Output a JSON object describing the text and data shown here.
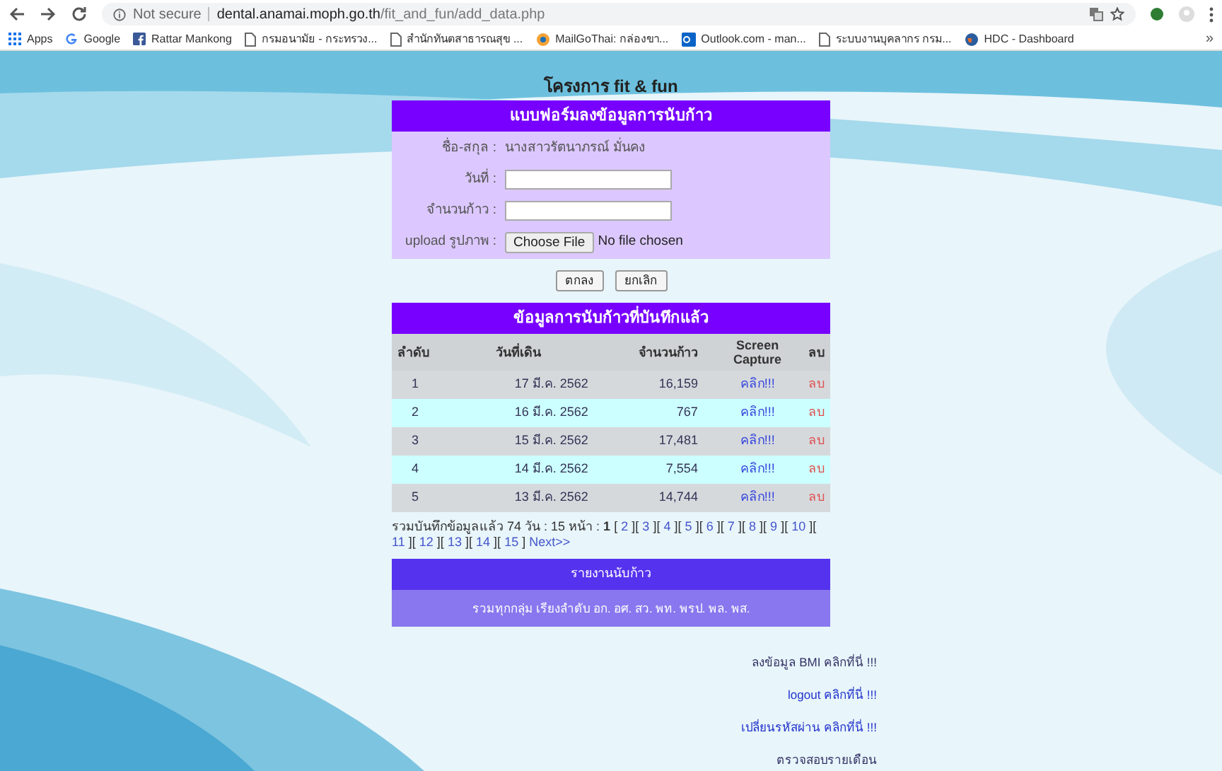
{
  "browser": {
    "security": "Not secure",
    "url_host": "dental.anamai.moph.go.th",
    "url_path": "/fit_and_fun/add_data.php",
    "bookmarks": [
      {
        "label": "Apps",
        "kind": "apps"
      },
      {
        "label": "Google",
        "kind": "google"
      },
      {
        "label": "Rattar Mankong",
        "kind": "facebook"
      },
      {
        "label": "กรมอนามัย - กระทรวง...",
        "kind": "page"
      },
      {
        "label": "สำนักทันตสาธารณสุข ...",
        "kind": "page"
      },
      {
        "label": "MailGoThai: กล่องขา...",
        "kind": "mail"
      },
      {
        "label": "Outlook.com - man...",
        "kind": "outlook"
      },
      {
        "label": "ระบบงานบุคลากร กรม...",
        "kind": "page"
      },
      {
        "label": "HDC - Dashboard",
        "kind": "globe"
      }
    ],
    "overflow": "»"
  },
  "page_title": "โครงการ fit & fun",
  "form": {
    "title": "แบบฟอร์มลงข้อมูลการนับก้าว",
    "fields": [
      {
        "label": "ชื่อ-สกุล :",
        "kind": "static",
        "value": "นางสาวรัตนาภรณ์ มั่นคง"
      },
      {
        "label": "วันที่ :",
        "kind": "text"
      },
      {
        "label": "จำนวนก้าว :",
        "kind": "text"
      },
      {
        "label": "upload รูปภาพ :",
        "kind": "file",
        "button": "Choose File",
        "value": "No file chosen"
      }
    ],
    "buttons": [
      "ตกลง",
      "ยกเลิก"
    ]
  },
  "records": {
    "title": "ข้อมูลการนับก้าวที่บันทึกแล้ว",
    "columns": [
      "ลำดับ",
      "วันที่เดิน",
      "จำนวนก้าว",
      "Screen Capture",
      "ลบ"
    ],
    "rows": [
      [
        "1",
        "17 มี.ค. 2562",
        "16,159",
        "คลิก!!!",
        "ลบ"
      ],
      [
        "2",
        "16 มี.ค. 2562",
        "767",
        "คลิก!!!",
        "ลบ"
      ],
      [
        "3",
        "15 มี.ค. 2562",
        "17,481",
        "คลิก!!!",
        "ลบ"
      ],
      [
        "4",
        "14 มี.ค. 2562",
        "7,554",
        "คลิก!!!",
        "ลบ"
      ],
      [
        "5",
        "13 มี.ค. 2562",
        "14,744",
        "คลิก!!!",
        "ลบ"
      ]
    ]
  },
  "pagination": [
    {
      "kind": "text",
      "text": "รวมบันทึกข้อมูลแล้ว 74 วัน : 15 หน้า :"
    },
    {
      "kind": "current",
      "text": "1"
    },
    {
      "kind": "sep",
      "text": "["
    },
    {
      "kind": "link",
      "text": "2"
    },
    {
      "kind": "sep",
      "text": "]["
    },
    {
      "kind": "link",
      "text": "3"
    },
    {
      "kind": "sep",
      "text": "]["
    },
    {
      "kind": "link",
      "text": "4"
    },
    {
      "kind": "sep",
      "text": "]["
    },
    {
      "kind": "link",
      "text": "5"
    },
    {
      "kind": "sep",
      "text": "]["
    },
    {
      "kind": "link",
      "text": "6"
    },
    {
      "kind": "sep",
      "text": "]["
    },
    {
      "kind": "link",
      "text": "7"
    },
    {
      "kind": "sep",
      "text": "]["
    },
    {
      "kind": "link",
      "text": "8"
    },
    {
      "kind": "sep",
      "text": "]["
    },
    {
      "kind": "link",
      "text": "9"
    },
    {
      "kind": "sep",
      "text": "]["
    },
    {
      "kind": "link",
      "text": "10"
    },
    {
      "kind": "sep",
      "text": "]["
    },
    {
      "kind": "link",
      "text": "11"
    },
    {
      "kind": "sep",
      "text": "]["
    },
    {
      "kind": "link",
      "text": "12"
    },
    {
      "kind": "sep",
      "text": "]["
    },
    {
      "kind": "link",
      "text": "13"
    },
    {
      "kind": "sep",
      "text": "]["
    },
    {
      "kind": "link",
      "text": "14"
    },
    {
      "kind": "sep",
      "text": "]["
    },
    {
      "kind": "link",
      "text": "15"
    },
    {
      "kind": "sep",
      "text": "]"
    },
    {
      "kind": "link",
      "text": "Next>>"
    }
  ],
  "report": {
    "title": "รายงานนับก้าว",
    "link": "รวมทุกกลุ่ม เรียงลำดับ อก. อศ. สว. พท. พรป. พล. พส."
  },
  "side_links": [
    {
      "text": "ลงข้อมูล BMI คลิกที่นี่ !!!",
      "kind": "dark"
    },
    {
      "text": "logout คลิกที่นี่ !!!",
      "kind": "blue"
    },
    {
      "text": "เปลี่ยนรหัสผ่าน คลิกที่นี่ !!!",
      "kind": "blue"
    },
    {
      "text": "ตรวจสอบรายเดือน",
      "kind": "dark"
    }
  ]
}
